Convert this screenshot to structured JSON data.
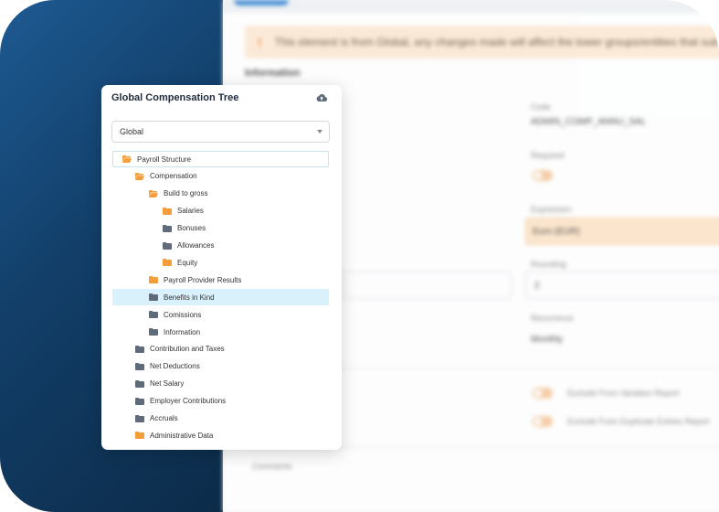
{
  "tree": {
    "title": "Global Compensation Tree",
    "cloud_icon": "cloud-upload-icon",
    "selector": {
      "value": "Global"
    },
    "colors": {
      "folder_open": "#f59c3b",
      "folder_closed": "#5f6b7a",
      "selected_bg": "#d8f1fb"
    },
    "items": [
      {
        "label": "Payroll Structure",
        "level": 0,
        "icon": "folder-open-icon",
        "color": "orange",
        "root": true
      },
      {
        "label": "Compensation",
        "level": 1,
        "icon": "folder-open-icon",
        "color": "orange"
      },
      {
        "label": "Build to gross",
        "level": 2,
        "icon": "folder-open-icon",
        "color": "orange"
      },
      {
        "label": "Salaries",
        "level": 3,
        "icon": "folder-icon",
        "color": "orange"
      },
      {
        "label": "Bonuses",
        "level": 3,
        "icon": "folder-icon",
        "color": "gray"
      },
      {
        "label": "Allowances",
        "level": 3,
        "icon": "folder-icon",
        "color": "gray"
      },
      {
        "label": "Equity",
        "level": 3,
        "icon": "folder-icon",
        "color": "orange"
      },
      {
        "label": "Payroll Provider Results",
        "level": 2,
        "icon": "folder-icon",
        "color": "orange"
      },
      {
        "label": "Benefits in Kind",
        "level": 2,
        "icon": "folder-icon",
        "color": "gray",
        "selected": true
      },
      {
        "label": "Comissions",
        "level": 2,
        "icon": "folder-icon",
        "color": "gray"
      },
      {
        "label": "Information",
        "level": 2,
        "icon": "folder-icon",
        "color": "gray"
      },
      {
        "label": "Contribution and Taxes",
        "level": 1,
        "icon": "folder-icon",
        "color": "gray"
      },
      {
        "label": "Net Deductions",
        "level": 1,
        "icon": "folder-icon",
        "color": "gray"
      },
      {
        "label": "Net Salary",
        "level": 1,
        "icon": "folder-icon",
        "color": "gray"
      },
      {
        "label": "Employer Contributions",
        "level": 1,
        "icon": "folder-icon",
        "color": "gray"
      },
      {
        "label": "Accruals",
        "level": 1,
        "icon": "folder-icon",
        "color": "gray"
      },
      {
        "label": "Administrative Data",
        "level": 1,
        "icon": "folder-icon",
        "color": "orange"
      }
    ]
  },
  "background": {
    "alert_text": "This element is from Global, any changes made will affect the lower groups/entities that sub",
    "section_title": "Information",
    "fields": {
      "code_label": "Code",
      "code_value": "ADMIN_COMP_ANNU_SAL",
      "required_label": "Required",
      "expression_label": "Expression",
      "expression_value": "Euro (EUR)",
      "rounding_label": "Rounding",
      "rounding_value": "2",
      "recurrence_label": "Recurrence",
      "recurrence_value": "Monthly",
      "exclude_variation": "Exclude From Variation Report",
      "exclude_duplicate": "Exclude From Duplicate Entries Report",
      "comments_label": "Comments"
    }
  }
}
